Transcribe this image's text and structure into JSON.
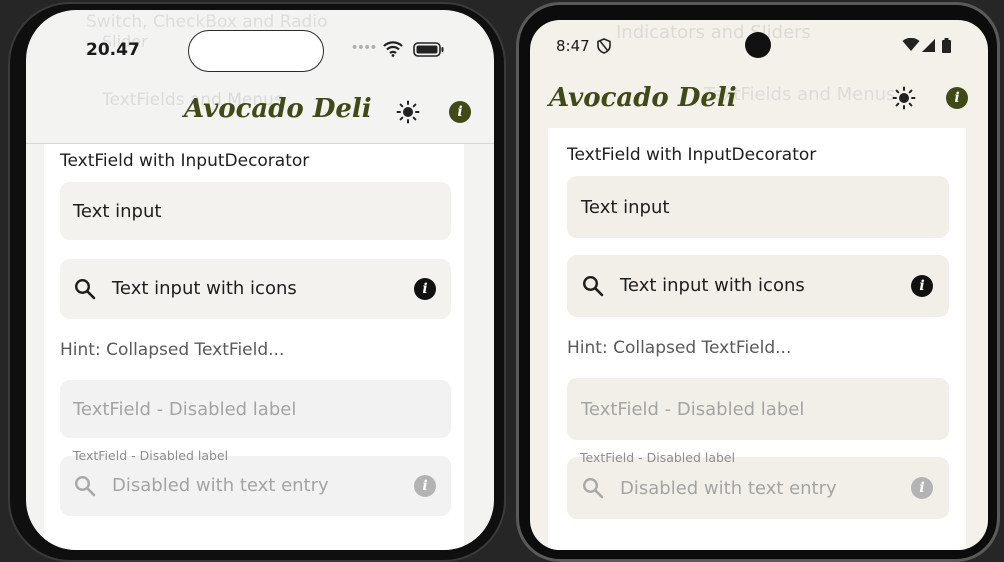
{
  "app": {
    "title": "Avocado Deli"
  },
  "ios": {
    "status_time": "20.47",
    "ghost_lines": [
      "Switch, CheckBox and Radio",
      "Slider",
      "TextFields and Menus"
    ]
  },
  "android": {
    "status_time": "8:47",
    "ghost_lines": [
      "Indicators and Sliders",
      "TextFields and Menus"
    ]
  },
  "content": {
    "section_title": "TextField with InputDecorator",
    "text_input": "Text input",
    "text_input_icons": "Text input with icons",
    "hint": "Hint: Collapsed TextField...",
    "disabled_label": "TextField - Disabled label",
    "disabled_float_label": "TextField - Disabled label",
    "disabled_entry": "Disabled with text entry"
  },
  "colors": {
    "brand_olive": "#3f4a17",
    "ios_field_bg": "#f3f2ee",
    "android_field_bg": "#f1efe8",
    "disabled_bg": "#f2f2f2"
  },
  "icons": {
    "theme_toggle": "sun-icon",
    "info": "info-icon",
    "search": "search-icon"
  }
}
